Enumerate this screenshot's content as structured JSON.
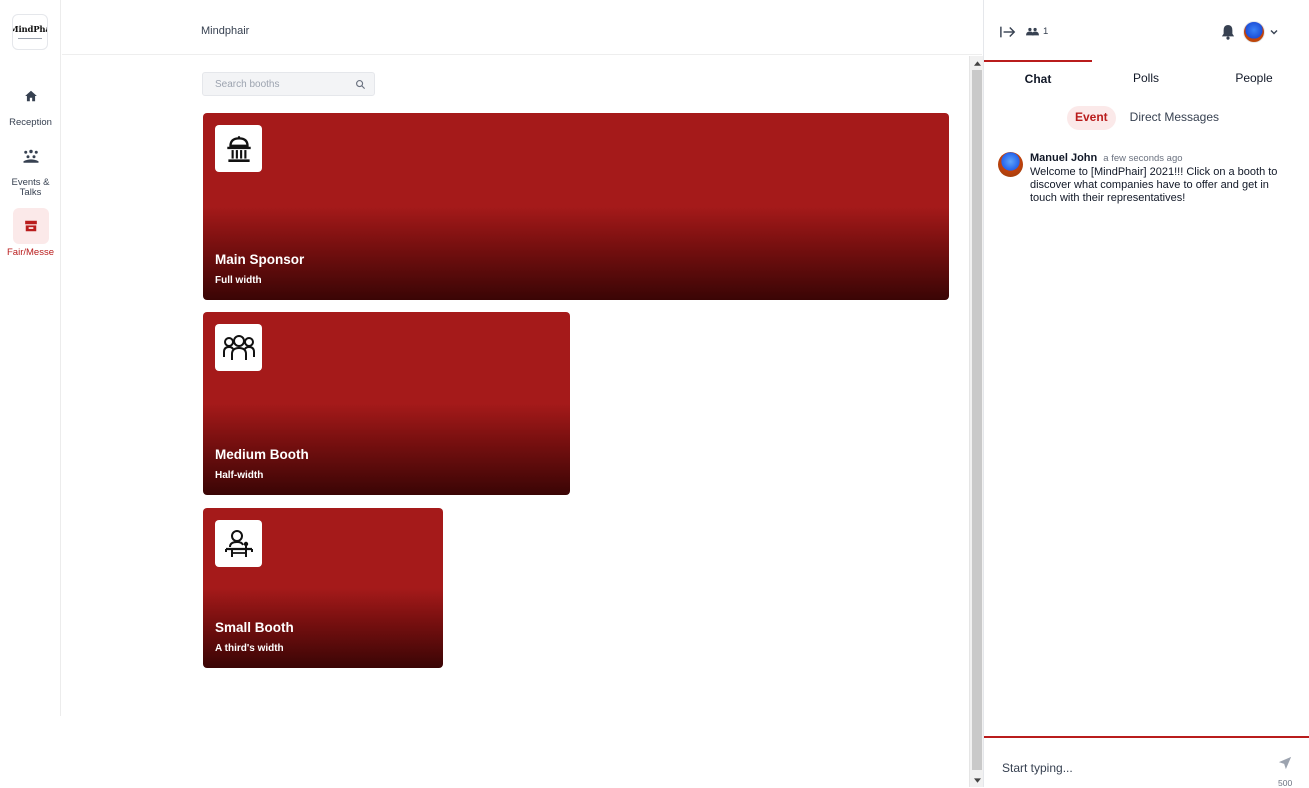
{
  "app": {
    "logo_text": "MindPha",
    "header_title": "Mindphair"
  },
  "nav": {
    "items": [
      {
        "label": "Reception",
        "icon": "home-icon",
        "active": false
      },
      {
        "label": "Events & Talks",
        "icon": "audience-icon",
        "active": false
      },
      {
        "label": "Fair/Messe",
        "icon": "booth-icon",
        "active": true
      }
    ]
  },
  "search": {
    "placeholder": "Search booths",
    "value": ""
  },
  "booths": [
    {
      "name": "Main Sponsor",
      "description": "Full width",
      "icon": "government-building-icon"
    },
    {
      "name": "Medium Booth",
      "description": "Half-width",
      "icon": "group-people-icon"
    },
    {
      "name": "Small Booth",
      "description": "A third's width",
      "icon": "person-at-desk-icon"
    }
  ],
  "panel": {
    "participant_count": "1",
    "tabs": [
      {
        "label": "Chat",
        "active": true
      },
      {
        "label": "Polls",
        "active": false
      },
      {
        "label": "People",
        "active": false
      }
    ],
    "subtabs": [
      {
        "label": "Event",
        "active": true
      },
      {
        "label": "Direct Messages",
        "active": false
      }
    ],
    "messages": [
      {
        "author": "Manuel John",
        "time": "a few seconds ago",
        "text": "Welcome to [MindPhair] 2021!!! Click on a booth to discover what companies have to offer and get in touch with their representatives!"
      }
    ],
    "composer": {
      "placeholder": "Start typing...",
      "value": "",
      "char_limit": "500"
    }
  },
  "colors": {
    "accent": "#b91c1c",
    "booth_red": "#a51a1a",
    "booth_dark": "#3a0505"
  }
}
